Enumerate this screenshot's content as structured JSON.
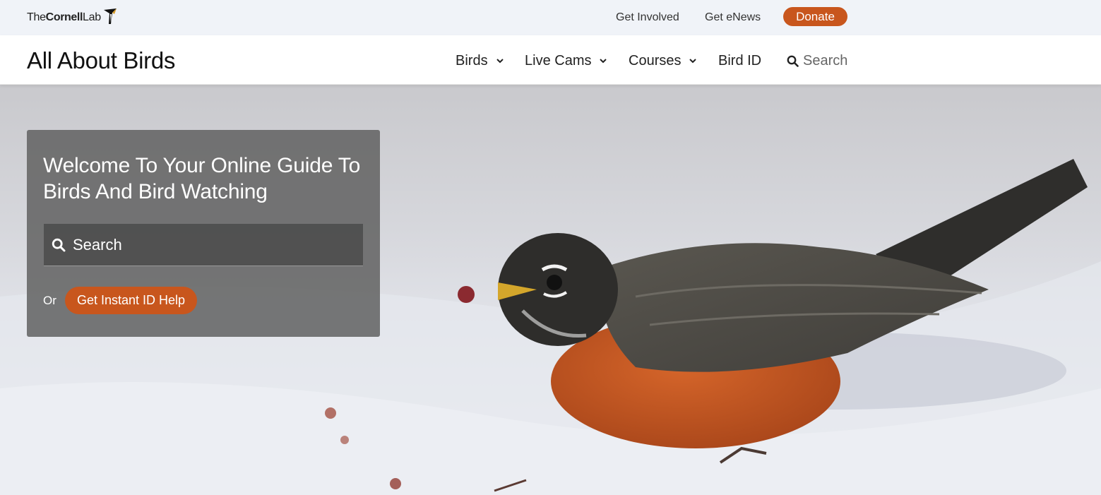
{
  "brand": {
    "logo_the": "The",
    "logo_cornell": "Cornell",
    "logo_lab": "Lab",
    "site_title": "All About Birds",
    "accent_color": "#c8561d"
  },
  "utility": {
    "get_involved": "Get Involved",
    "get_enews": "Get eNews",
    "donate": "Donate"
  },
  "nav": {
    "items": [
      {
        "label": "Birds",
        "icon": "chevron-down-icon"
      },
      {
        "label": "Live Cams",
        "icon": "chevron-down-icon"
      },
      {
        "label": "Courses",
        "icon": "chevron-down-icon"
      },
      {
        "label": "Bird ID"
      }
    ],
    "search_label": "Search",
    "search_icon": "search-icon"
  },
  "hero": {
    "title": "Welcome To Your Online Guide To Birds And Bird Watching",
    "search_placeholder": "Search",
    "or_text": "Or",
    "id_help_button": "Get Instant ID Help",
    "photo_subject": "robin-in-snow-photo"
  }
}
